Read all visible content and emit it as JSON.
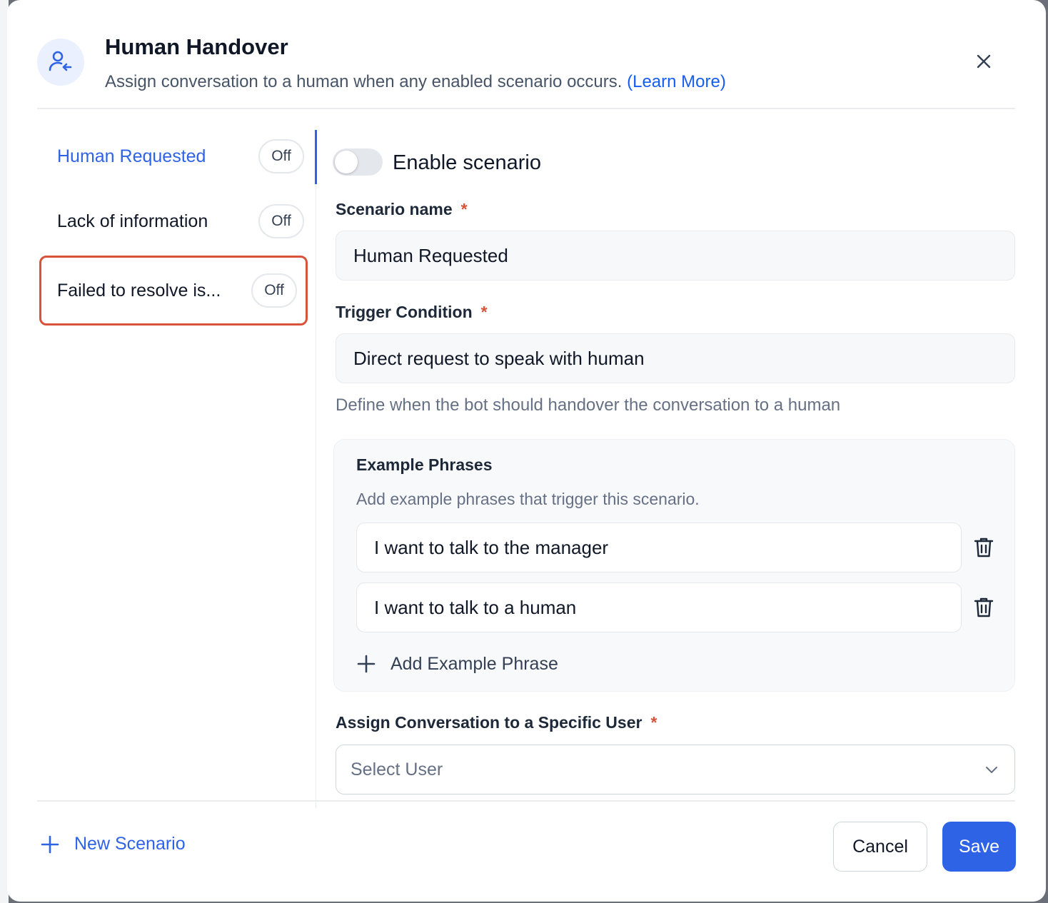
{
  "header": {
    "title": "Human Handover",
    "subtitle": "Assign conversation to a human when any enabled scenario occurs.",
    "learn_more": "(Learn More)"
  },
  "scenarios": [
    {
      "label": "Human Requested",
      "status": "Off",
      "active": true
    },
    {
      "label": "Lack of information",
      "status": "Off",
      "active": false
    },
    {
      "label": "Failed to resolve is...",
      "status": "Off",
      "active": false,
      "highlighted": true
    }
  ],
  "form": {
    "enable_label": "Enable scenario",
    "enabled": false,
    "scenario_name_label": "Scenario name",
    "scenario_name_value": "Human Requested",
    "trigger_label": "Trigger Condition",
    "trigger_value": "Direct request to speak with human",
    "trigger_hint": "Define when the bot should handover the conversation to a human",
    "required_mark": "*",
    "examples": {
      "title": "Example Phrases",
      "subtitle": "Add example phrases that trigger this scenario.",
      "phrases": [
        "I want to talk to the manager",
        "I want to talk to a human"
      ],
      "add_label": "Add Example Phrase"
    },
    "assign_label": "Assign Conversation to a Specific User",
    "assign_placeholder": "Select User"
  },
  "footer": {
    "new_scenario": "New Scenario",
    "cancel": "Cancel",
    "save": "Save"
  },
  "colors": {
    "accent": "#2f63e6",
    "highlight_border": "#d9523a",
    "required": "#d9523a"
  },
  "icons": {
    "header": "user-handover-icon",
    "close": "close-icon",
    "trash": "trash-icon",
    "plus": "plus-icon",
    "chevron": "chevron-down-icon"
  }
}
